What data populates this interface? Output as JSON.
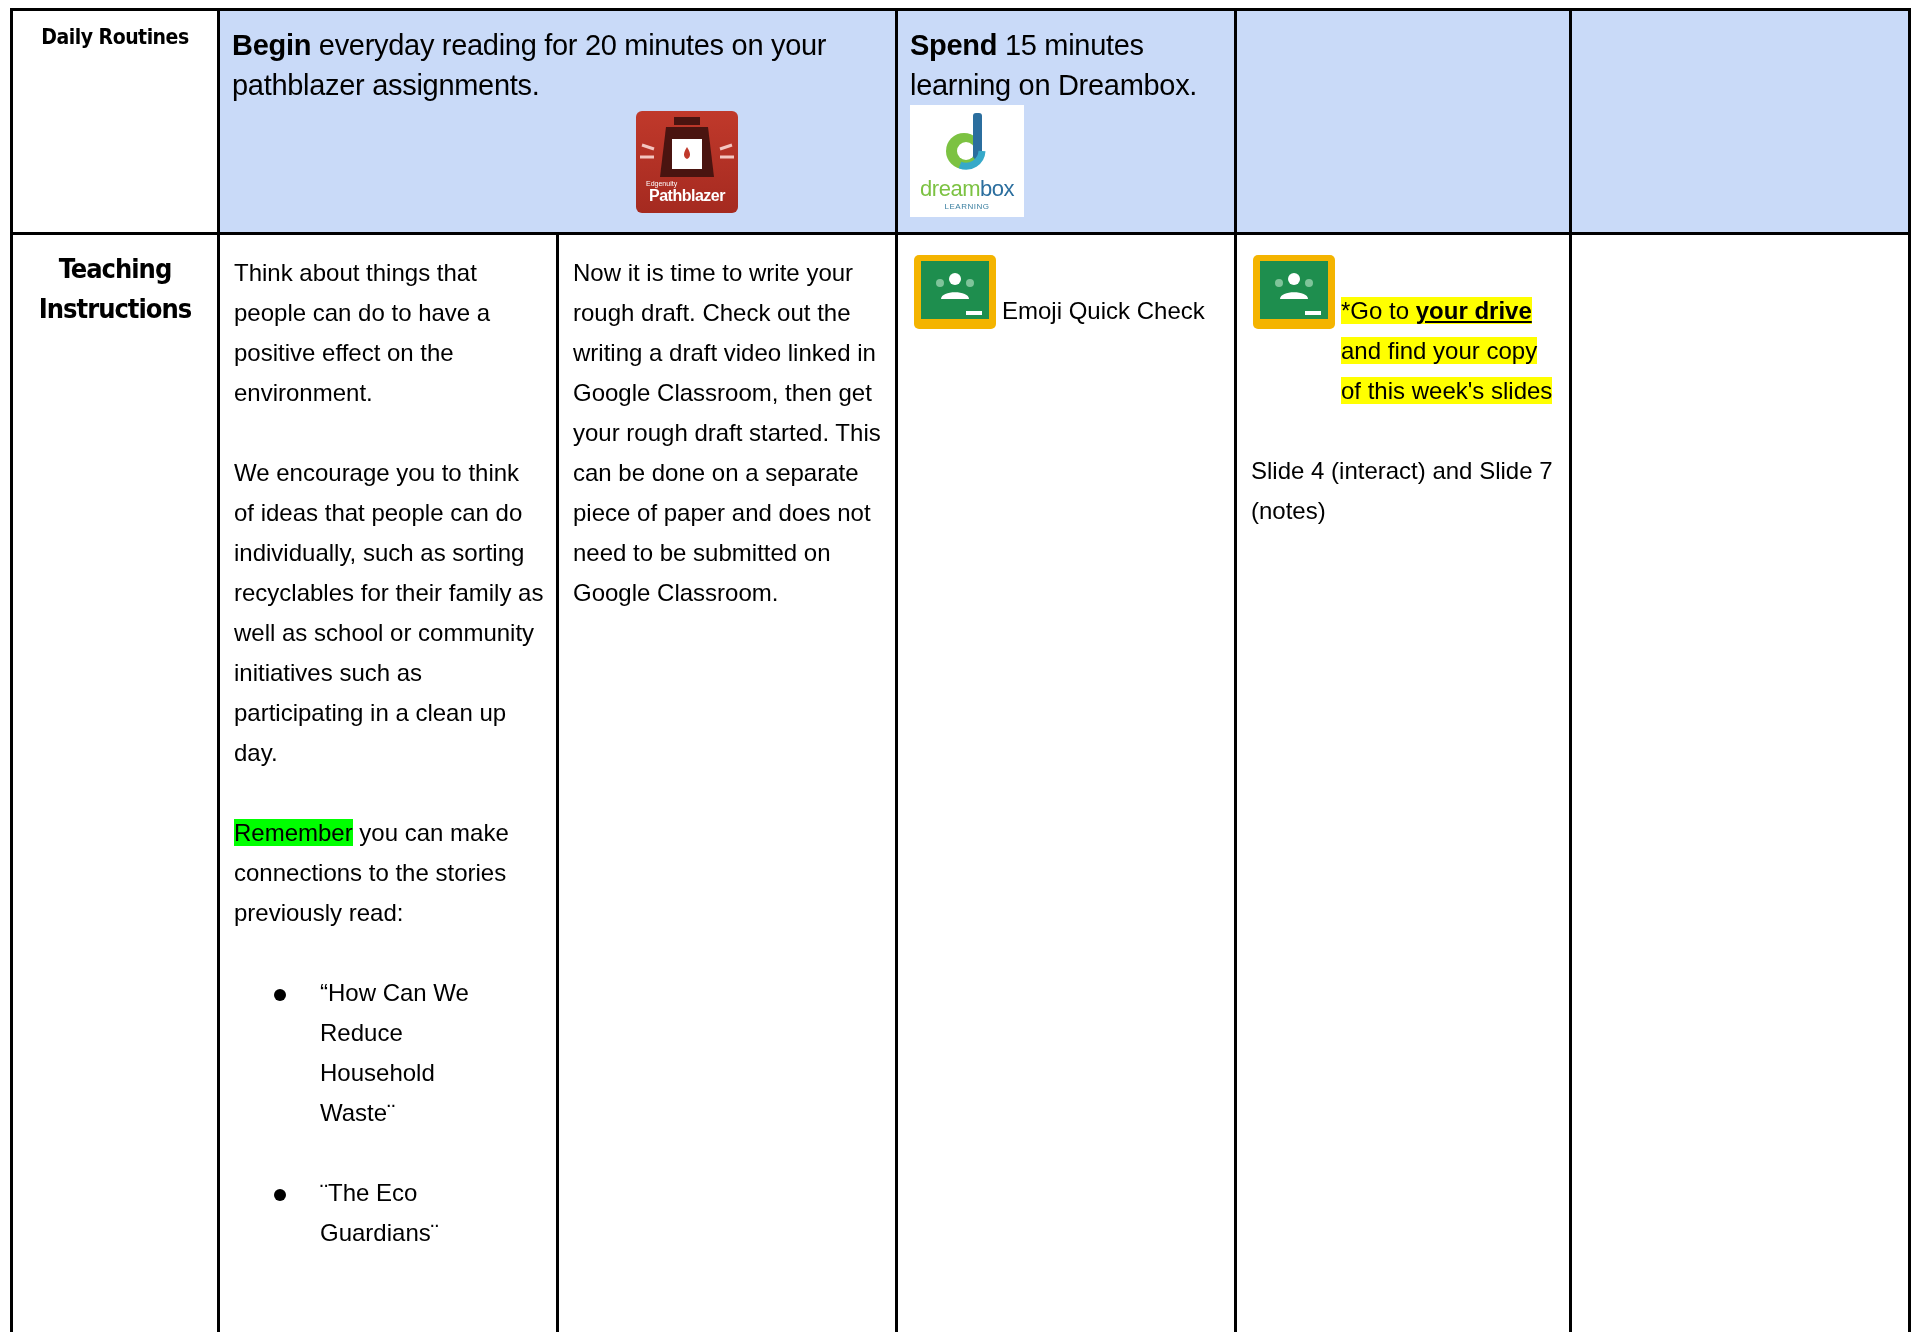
{
  "header_row": {
    "label": "Daily Routines",
    "cells": [
      {
        "kind": "wide",
        "text": "**Begin** everyday reading for 20 minutes on your pathblazer assignments.",
        "logo": {
          "kind": "pathblazer",
          "wordmark": "Pathblazer",
          "maker": "Edgenuity"
        }
      },
      {
        "kind": "normal",
        "text": "**Spend** 15 minutes learning on Dreambox.",
        "logo": {
          "kind": "dreambox",
          "wordmark_parts": [
            "dream",
            "box"
          ],
          "tagline": "LEARNING"
        }
      },
      {
        "kind": "normal"
      },
      {
        "kind": "normal"
      }
    ]
  },
  "instruction_row": {
    "label": "Teaching Instructions",
    "cells": [
      {
        "blocks": [
          {
            "kind": "paragraph",
            "runs": [
              {
                "text": "Think about things that people can do to have a positive effect on the environment."
              }
            ]
          },
          {
            "kind": "paragraph",
            "runs": [
              {
                "text": "We encourage you to think of ideas that people can do individually, such as sorting recyclables for their family as well as school or community initiatives such as participating in a clean up day."
              }
            ]
          },
          {
            "kind": "paragraph",
            "runs": [
              {
                "text": "Remember",
                "color": "#00ff00"
              },
              {
                "text": " you can make connections to the stories previously read:"
              }
            ]
          },
          {
            "kind": "bullets",
            "items": [
              "“How Can We Reduce Household Waste¨",
              "¨The Eco Guardians¨"
            ]
          }
        ]
      },
      {
        "blocks": [
          {
            "kind": "paragraph",
            "runs": [
              {
                "text": "Now it is time to write your rough draft.  Check out the writing a draft video linked in Google Classroom, then get your rough draft started.    This can be done on a separate piece of paper and does not need to be submitted on Google Classroom."
              }
            ]
          }
        ]
      },
      {
        "blocks": [
          {
            "kind": "classroom_paragraph",
            "runs": [
              {
                "text": "Emoji Quick Check"
              }
            ]
          }
        ]
      },
      {
        "blocks": [
          {
            "kind": "classroom_paragraph",
            "runs": [
              {
                "text": "*Go to ",
                "color": "#ffff00"
              },
              {
                "text": "your drive",
                "kind": "link",
                "color": "#ffff00"
              },
              {
                "text": " and find your copy of this week's slides",
                "color": "#ffff00"
              }
            ]
          },
          {
            "kind": "paragraph",
            "runs": [
              {
                "text": "Slide 4 (interact) and Slide 7 (notes)"
              }
            ]
          }
        ]
      },
      {}
    ]
  }
}
